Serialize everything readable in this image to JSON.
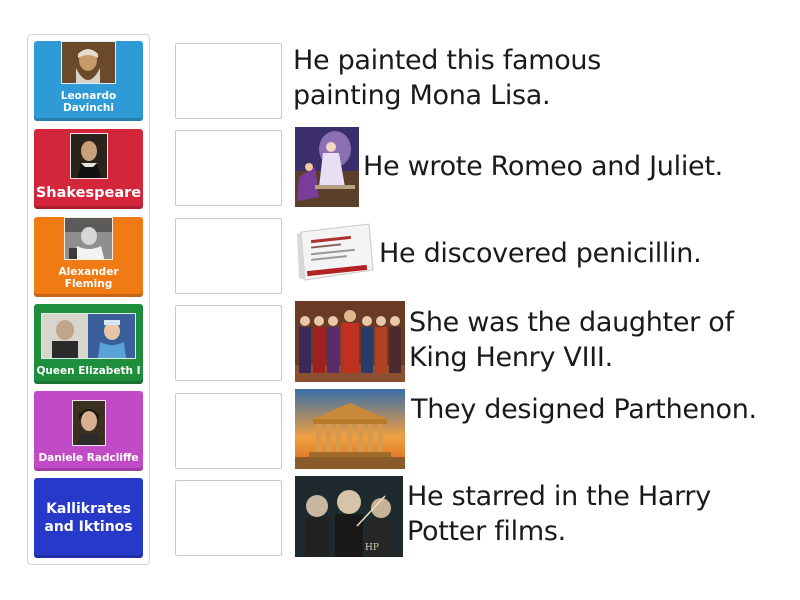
{
  "cards": [
    {
      "label": "Leonardo Davinchi",
      "color": "#2e9bd6",
      "image": "leonardo-portrait"
    },
    {
      "label": "Shakespeare",
      "color": "#d3263a",
      "image": "shakespeare-portrait"
    },
    {
      "label": "Alexander Fleming",
      "color": "#f07a14",
      "image": "fleming-photo"
    },
    {
      "label": "Queen Elizabeth I",
      "color": "#1e8d3c",
      "image": "queen-photo"
    },
    {
      "label": "Daniele Radcliffe",
      "color": "#c14bc6",
      "image": "radcliffe-photo"
    },
    {
      "label": "Kallikrates and Iktinos",
      "color": "#2639c9",
      "image": ""
    }
  ],
  "clues": [
    {
      "text": "He painted this famous painting Mona Lisa.",
      "image": ""
    },
    {
      "text": "He wrote Romeo and Juliet.",
      "image": "romeo-juliet-painting"
    },
    {
      "text": "He discovered penicillin.",
      "image": "penicillin-box"
    },
    {
      "text": "She was the daughter of King Henry VIII.",
      "image": "tudor-family-painting"
    },
    {
      "text": "They designed Parthenon.",
      "image": "parthenon-photo"
    },
    {
      "text": "He starred in the Harry Potter films.",
      "image": "harry-potter-poster"
    }
  ]
}
